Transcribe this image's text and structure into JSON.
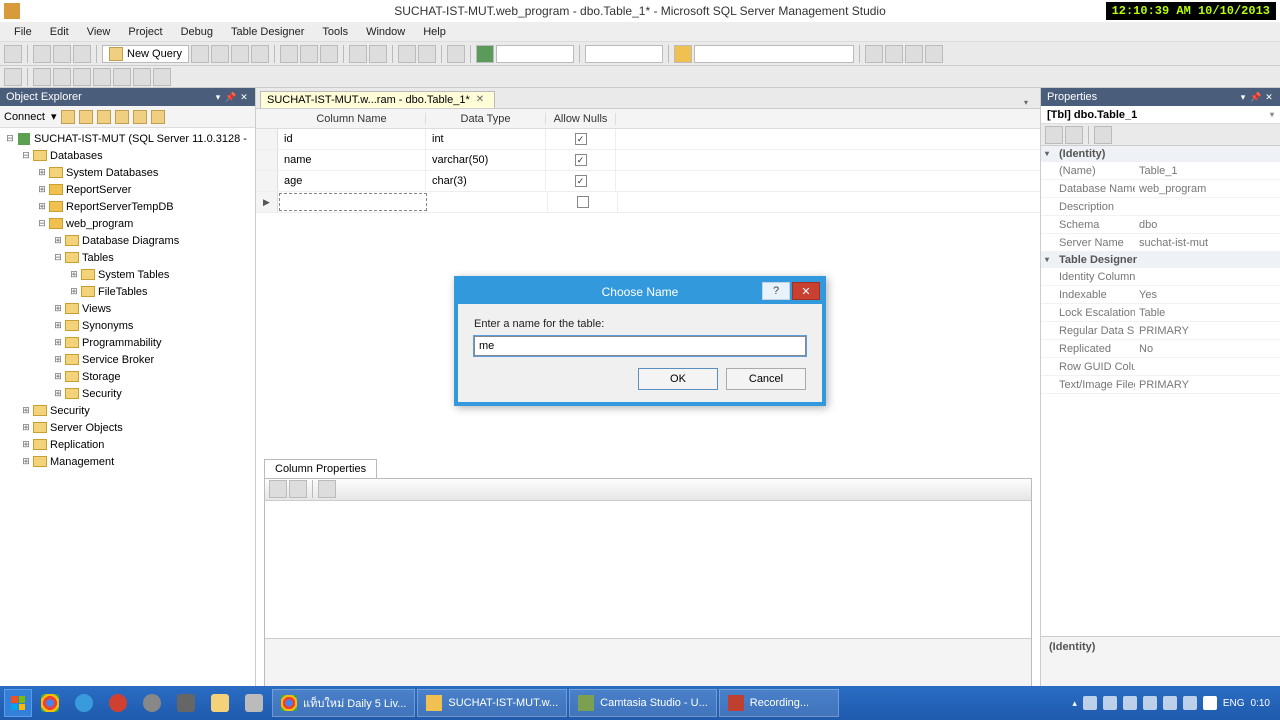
{
  "title": "SUCHAT-IST-MUT.web_program - dbo.Table_1* - Microsoft SQL Server Management Studio",
  "clock_overlay": "12:10:39 AM 10/10/2013",
  "menu": [
    "File",
    "Edit",
    "View",
    "Project",
    "Debug",
    "Table Designer",
    "Tools",
    "Window",
    "Help"
  ],
  "toolbar": {
    "new_query": "New Query"
  },
  "object_explorer": {
    "title": "Object Explorer",
    "connect": "Connect",
    "root": "SUCHAT-IST-MUT (SQL Server 11.0.3128 -",
    "nodes": {
      "databases": "Databases",
      "system_databases": "System Databases",
      "reportserver": "ReportServer",
      "reportservertempdb": "ReportServerTempDB",
      "web_program": "web_program",
      "database_diagrams": "Database Diagrams",
      "tables": "Tables",
      "system_tables": "System Tables",
      "file_tables": "FileTables",
      "views": "Views",
      "synonyms": "Synonyms",
      "programmability": "Programmability",
      "service_broker": "Service Broker",
      "storage": "Storage",
      "security_db": "Security",
      "security": "Security",
      "server_objects": "Server Objects",
      "replication": "Replication",
      "management": "Management"
    }
  },
  "editor": {
    "tab": "SUCHAT-IST-MUT.w...ram - dbo.Table_1*",
    "headers": {
      "col": "Column Name",
      "dtype": "Data Type",
      "nulls": "Allow Nulls"
    },
    "rows": [
      {
        "name": "id",
        "type": "int",
        "nulls": true
      },
      {
        "name": "name",
        "type": "varchar(50)",
        "nulls": true
      },
      {
        "name": "age",
        "type": "char(3)",
        "nulls": true
      }
    ],
    "column_properties": "Column Properties"
  },
  "properties": {
    "title": "Properties",
    "target": "[Tbl] dbo.Table_1",
    "identity_cat": "(Identity)",
    "designer_cat": "Table Designer",
    "rows": {
      "name_k": "(Name)",
      "name_v": "Table_1",
      "dbname_k": "Database Name",
      "dbname_v": "web_program",
      "desc_k": "Description",
      "desc_v": "",
      "schema_k": "Schema",
      "schema_v": "dbo",
      "server_k": "Server Name",
      "server_v": "suchat-ist-mut",
      "idcol_k": "Identity Column",
      "idcol_v": "",
      "index_k": "Indexable",
      "index_v": "Yes",
      "lock_k": "Lock Escalation",
      "lock_v": "Table",
      "reg_k": "Regular Data Spac",
      "reg_v": "PRIMARY",
      "rep_k": "Replicated",
      "rep_v": "No",
      "guid_k": "Row GUID Colum",
      "guid_v": "",
      "txt_k": "Text/Image Filegr",
      "txt_v": "PRIMARY"
    },
    "desc_title": "(Identity)"
  },
  "dialog": {
    "title": "Choose Name",
    "label": "Enter a name for the table:",
    "value": "me",
    "ok": "OK",
    "cancel": "Cancel"
  },
  "taskbar": {
    "tasks": [
      "แท็บใหม่  Daily 5 Liv...",
      "SUCHAT-IST-MUT.w...",
      "Camtasia Studio - U...",
      "Recording..."
    ],
    "lang": "ENG",
    "time": "0:10"
  }
}
